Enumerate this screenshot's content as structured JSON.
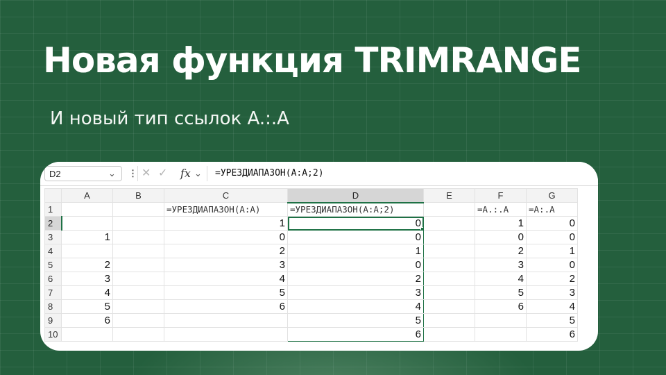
{
  "slide": {
    "title": "Новая функция TRIMRANGE",
    "subtitle": "И новый тип ссылок A.:.A"
  },
  "formula_bar": {
    "name_box": "D2",
    "formula": "=УРЕЗДИАПАЗОН(A:A;2)",
    "icons": [
      "chevron-down-icon",
      "more-icon",
      "cancel-icon",
      "enter-icon",
      "fx-icon"
    ]
  },
  "sheet": {
    "selected_cell": "D2",
    "columns": [
      "A",
      "B",
      "C",
      "D",
      "E",
      "F",
      "G"
    ],
    "rows": [
      {
        "num": "1",
        "cells": [
          "",
          "",
          "=УРЕЗДИАПАЗОН(A:A)",
          "=УРЕЗДИАПАЗОН(A:A;2)",
          "",
          "=A.:.A",
          "=A:.A"
        ]
      },
      {
        "num": "2",
        "cells": [
          "",
          "",
          "1",
          "0",
          "",
          "1",
          "0"
        ]
      },
      {
        "num": "3",
        "cells": [
          "1",
          "",
          "0",
          "0",
          "",
          "0",
          "0"
        ]
      },
      {
        "num": "4",
        "cells": [
          "",
          "",
          "2",
          "1",
          "",
          "2",
          "1"
        ]
      },
      {
        "num": "5",
        "cells": [
          "2",
          "",
          "3",
          "0",
          "",
          "3",
          "0"
        ]
      },
      {
        "num": "6",
        "cells": [
          "3",
          "",
          "4",
          "2",
          "",
          "4",
          "2"
        ]
      },
      {
        "num": "7",
        "cells": [
          "4",
          "",
          "5",
          "3",
          "",
          "5",
          "3"
        ]
      },
      {
        "num": "8",
        "cells": [
          "5",
          "",
          "6",
          "4",
          "",
          "6",
          "4"
        ]
      },
      {
        "num": "9",
        "cells": [
          "6",
          "",
          "",
          "5",
          "",
          "",
          "5"
        ]
      },
      {
        "num": "10",
        "cells": [
          "",
          "",
          "",
          "6",
          "",
          "",
          "6"
        ]
      }
    ]
  },
  "colors": {
    "background": "#245f3d",
    "selection": "#1e7145"
  }
}
